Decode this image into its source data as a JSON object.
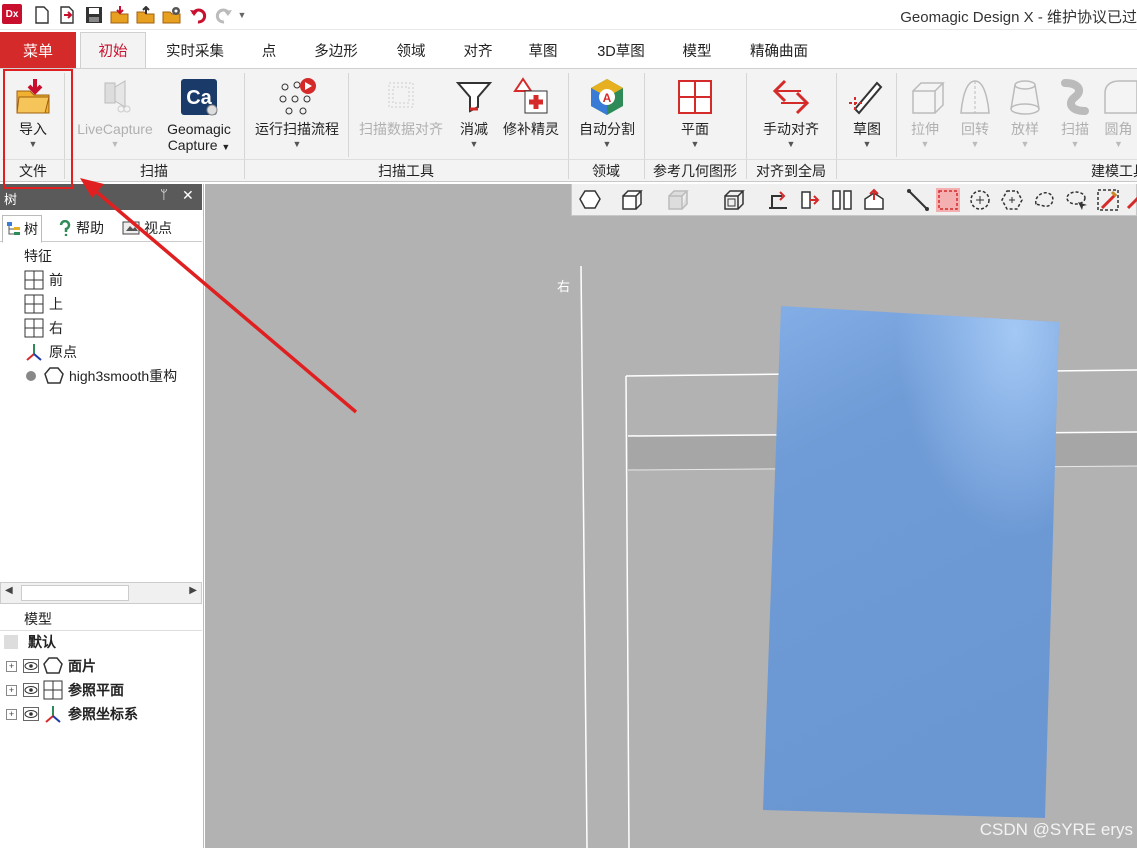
{
  "app": {
    "logo_text": "Dx",
    "window_title": "Geomagic Design X - 维护协议已过"
  },
  "tabs": {
    "menu": "菜单",
    "items": [
      "初始",
      "实时采集",
      "点",
      "多边形",
      "领域",
      "对齐",
      "草图",
      "3D草图",
      "模型",
      "精确曲面"
    ],
    "active": "初始"
  },
  "ribbon": {
    "import": "导入",
    "livecapture": "LiveCapture",
    "geomagic_capture_1": "Geomagic",
    "geomagic_capture_2": "Capture",
    "run_scan_flow": "运行扫描流程",
    "scan_data_align": "扫描数据对齐",
    "reduce": "消减",
    "repair_wizard": "修补精灵",
    "auto_segment": "自动分割",
    "plane": "平面",
    "manual_align": "手动对齐",
    "sketch": "草图",
    "extrude": "拉伸",
    "revolve": "回转",
    "loft": "放样",
    "sweep": "扫描",
    "fillet": "圆角",
    "ca_logo": "Ca",
    "groups": {
      "file": "文件",
      "scan": "扫描",
      "scan_tools": "扫描工具",
      "region": "领域",
      "ref_geometry": "参考几何图形",
      "align_global": "对齐到全局",
      "modeling_tools": "建模工具"
    }
  },
  "left_panel": {
    "title": "树",
    "tabs": [
      "树",
      "帮助",
      "视点"
    ],
    "features_heading": "特征",
    "features": [
      "前",
      "上",
      "右",
      "原点",
      "high3smooth重构"
    ],
    "model_heading": "模型",
    "model_items": [
      "默认",
      "面片",
      "参照平面",
      "参照坐标系"
    ]
  },
  "viewport": {
    "view_label": "右",
    "watermark": "CSDN @SYRE erys",
    "mesh_color": "#6f9bd6"
  },
  "annotation": {
    "highlight_color": "#e02020"
  }
}
